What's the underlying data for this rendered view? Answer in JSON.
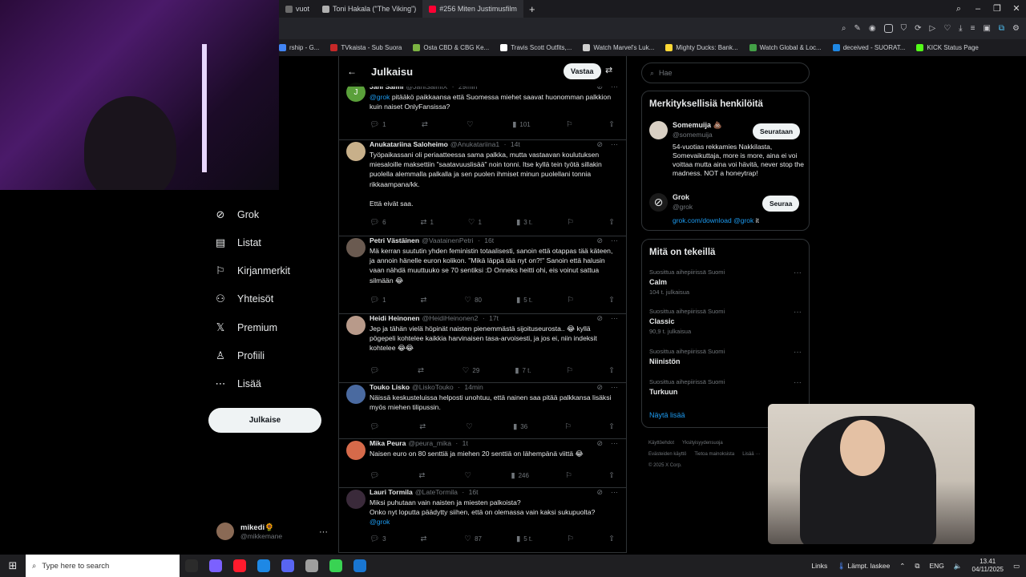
{
  "browser": {
    "tabs": [
      {
        "label": "vuot",
        "color": "#6b6b6b"
      },
      {
        "label": "Toni Hakala (\"The Viking\")",
        "color": "#b0b0b0"
      },
      {
        "label": "#256 Miten Justimusfilm",
        "color": "#ff0033"
      }
    ],
    "new_tab": "+",
    "bookmarks": [
      {
        "label": "rship - G...",
        "color": "#4285f4"
      },
      {
        "label": "TVkaista - Sub Suora",
        "color": "#c62828"
      },
      {
        "label": "Osta CBD & CBG Ke...",
        "color": "#7cb342"
      },
      {
        "label": "Travis Scott Outfits,...",
        "color": "#ffffff"
      },
      {
        "label": "Watch Marvel's Luk...",
        "color": "#cfcfcf"
      },
      {
        "label": "Mighty Ducks: Bank...",
        "color": "#fdd835"
      },
      {
        "label": "Watch Global & Loc...",
        "color": "#43a047"
      },
      {
        "label": "deceived - SUORAT...",
        "color": "#1e88e5"
      },
      {
        "label": "KICK Status Page",
        "color": "#53fc18"
      }
    ]
  },
  "nav": {
    "items": [
      {
        "label": "Grok",
        "icon": "grok-icon",
        "glyph": "⊘"
      },
      {
        "label": "Listat",
        "icon": "list-icon",
        "glyph": "▤"
      },
      {
        "label": "Kirjanmerkit",
        "icon": "bookmark-icon",
        "glyph": "⚐"
      },
      {
        "label": "Yhteisöt",
        "icon": "communities-icon",
        "glyph": "⚇"
      },
      {
        "label": "Premium",
        "icon": "x-logo-icon",
        "glyph": "𝕏"
      },
      {
        "label": "Profiili",
        "icon": "profile-icon",
        "glyph": "♙"
      },
      {
        "label": "Lisää",
        "icon": "more-icon",
        "glyph": "⋯"
      }
    ],
    "post_button": "Julkaise",
    "account": {
      "name": "mikedi🌻",
      "handle": "@mikkemane"
    }
  },
  "header": {
    "title": "Julkaisu",
    "reply_button": "Vastaa"
  },
  "posts": [
    {
      "name": "Jani Salmi",
      "handle": "@JaniSalmiX",
      "time": "29min",
      "avatar": "#5aa03a",
      "initial": "J",
      "mention": "@grok",
      "text": "pitääkö paikkaansa että Suomessa miehet saavat huonomman palkkion kuin naiset OnlyFansissa?",
      "replies": "1",
      "reposts": "",
      "likes": "",
      "views": "101"
    },
    {
      "name": "Anukatariina Saloheimo",
      "handle": "@Anukatariina1",
      "time": "14t",
      "avatar": "#c8b08a",
      "text": "Työpaikassani oli periaatteessa sama palkka, mutta vastaavan koulutuksen miesaloille maksettiin \"saatavuuslisää\" noin tonni. Itse kyllä tein työtä sillakin puolella alemmalla palkalla ja sen puolen ihmiset minun puolellani tonnia rikkaampana/kk.\n\nEttä eivät saa.",
      "replies": "6",
      "reposts": "1",
      "likes": "1",
      "views": "3 t."
    },
    {
      "name": "Petri Västäinen",
      "handle": "@VaatainenPetri",
      "time": "16t",
      "avatar": "#6a5a50",
      "text": "Mä kerran suututin yhden feministin totaalisesti, sanoin että otappas tää käteen, ja annoin hänelle euron kolikon. \"Mikä läppä tää nyt on?!\" Sanoin että halusin vaan nähdä muuttuuko se 70 sentiksi :D Onneks heitti ohi, eis voinut sattua silmään 😂",
      "replies": "1",
      "reposts": "",
      "likes": "80",
      "views": "5 t."
    },
    {
      "name": "Heidi Heinonen",
      "handle": "@HeidiHeinonen2",
      "time": "17t",
      "avatar": "#b89a8a",
      "text": "Jep ja tähän vielä höpinät naisten pienemmästä sijoituseurosta.. 😂 kyllä pögepeli kohtelee kaikkia harvinaisen tasa-arvoisesti, ja jos ei, niin indeksit kohtelee 😂😂",
      "replies": "",
      "reposts": "",
      "likes": "29",
      "views": "7 t."
    },
    {
      "name": "Touko Lisko",
      "handle": "@LiskoTouko",
      "time": "14min",
      "avatar": "#4a6aa0",
      "text": "Näissä keskusteluissa helposti unohtuu, että nainen saa pitää palkkansa lisäksi myös miehen tilipussin.",
      "replies": "",
      "reposts": "",
      "likes": "",
      "views": "36"
    },
    {
      "name": "Mika Peura",
      "handle": "@peura_mika",
      "time": "1t",
      "avatar": "#d66a4a",
      "text": "Naisen euro on 80 senttiä ja miehen 20 senttiä on lähempänä viittä 😂",
      "replies": "",
      "reposts": "",
      "likes": "",
      "views": "246"
    },
    {
      "name": "Lauri Tormila",
      "handle": "@LateTormila",
      "time": "16t",
      "avatar": "#3a2a3a",
      "text": "Miksi puhutaan vain naisten ja miesten palkoista?\nOnko nyt loputta päädytty siihen, että on olemassa vain kaksi sukupuolta?",
      "mention_end": "@grok",
      "replies": "3",
      "reposts": "",
      "likes": "87",
      "views": "5 t."
    }
  ],
  "right": {
    "search_placeholder": "Hae",
    "who_title": "Merkityksellisiä henkilöitä",
    "who": [
      {
        "name": "Somemuija 💩",
        "handle": "@somemuija",
        "button": "Seurataan",
        "avatar": "#d9d0c4",
        "bio": "54-vuotias rekkamies Nakkilasta, Somevaikuttaja, more is more, aina ei voi voittaa mutta aina voi hävitä, never stop the madness. NOT a honeytrap!"
      },
      {
        "name": "Grok",
        "handle": "@grok",
        "button": "Seuraa",
        "avatar": "#1a1a1a",
        "bio_link": "grok.com/download",
        "bio_mention": "@grok",
        "bio_tail": " it"
      }
    ],
    "trends_title": "Mitä on tekeillä",
    "trends": [
      {
        "context": "Suosittua aihepiirissä Suomi",
        "topic": "Calm",
        "count": "104 t. julkaisua"
      },
      {
        "context": "Suosittua aihepiirissä Suomi",
        "topic": "Classic",
        "count": "90,9 t. julkaisua"
      },
      {
        "context": "Suosittua aihepiirissä Suomi",
        "topic": "Niinistön",
        "count": ""
      },
      {
        "context": "Suosittua aihepiirissä Suomi",
        "topic": "Turkuun",
        "count": ""
      }
    ],
    "show_more": "Näytä lisää",
    "footer": [
      "Käyttöehdot",
      "Yksityisyydensuoja",
      "Evästeiden käyttö",
      "Tietoa mainoksista",
      "Lisää ···",
      "© 2025 X Corp."
    ]
  },
  "taskbar": {
    "search_placeholder": "Type here to search",
    "links": "Links",
    "weather": "Lämpt. laskee",
    "lang": "ENG",
    "time": "13.41",
    "date": "04/11/2025",
    "apps": [
      {
        "name": "task-view",
        "color": "#2b2b2b"
      },
      {
        "name": "app-colorful",
        "color": "#7b61ff"
      },
      {
        "name": "opera",
        "color": "#ff1b2d"
      },
      {
        "name": "edge",
        "color": "#1e88e5"
      },
      {
        "name": "discord",
        "color": "#5865f2"
      },
      {
        "name": "app-grey",
        "color": "#9e9e9e"
      },
      {
        "name": "app-green",
        "color": "#39d353"
      },
      {
        "name": "app-blue",
        "color": "#1976d2"
      }
    ]
  }
}
